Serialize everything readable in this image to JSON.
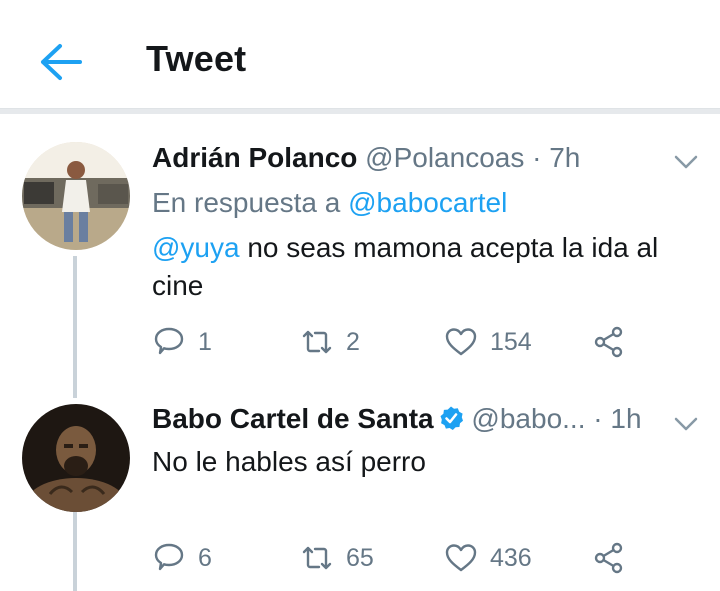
{
  "header": {
    "title": "Tweet",
    "back_icon": "arrow-left-icon",
    "accent": "#1da1f2"
  },
  "tweets": [
    {
      "name": "Adrián Polanco",
      "handle": "@Polancoas",
      "separator": "·",
      "time": "7h",
      "reply_prefix": "En respuesta a",
      "reply_to": "@babocartel",
      "mention": "@yuya",
      "body_line1": " no seas mamona acepta la ida al",
      "body_line2": "cine",
      "replies": "1",
      "retweets": "2",
      "likes": "154"
    },
    {
      "name": "Babo Cartel de Santa",
      "verified": true,
      "handle": "@babo...",
      "separator": "·",
      "time": "1h",
      "body_line1": "No le hables así perro",
      "replies": "6",
      "retweets": "65",
      "likes": "436"
    }
  ],
  "icons": {
    "reply": "comment-icon",
    "retweet": "retweet-icon",
    "like": "heart-icon",
    "share": "share-icon",
    "more": "chevron-down-icon"
  }
}
